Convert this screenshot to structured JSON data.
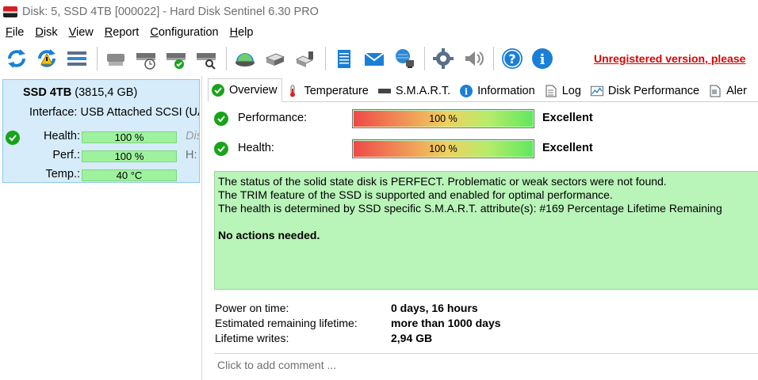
{
  "window": {
    "title": "Disk: 5, SSD 4TB [000022]  -  Hard Disk Sentinel 6.30 PRO"
  },
  "menu": [
    {
      "label": "File",
      "key": "F",
      "rest": "ile"
    },
    {
      "label": "Disk",
      "key": "D",
      "rest": "isk"
    },
    {
      "label": "View",
      "key": "V",
      "rest": "iew"
    },
    {
      "label": "Report",
      "key": "R",
      "rest": "eport"
    },
    {
      "label": "Configuration",
      "key": "C",
      "rest": "onfiguration"
    },
    {
      "label": "Help",
      "key": "H",
      "rest": "elp"
    }
  ],
  "toolbar": {
    "unregistered_text": "Unregistered version, please"
  },
  "disk_card": {
    "name": "SSD 4TB",
    "size": "(3815,4 GB)",
    "interface": "Interface: USB Attached SCSI (UA",
    "health_label": "Health:",
    "health_value": "100 %",
    "health_fraction": 1.0,
    "perf_label": "Perf.:",
    "perf_value": "100 %",
    "perf_fraction": 1.0,
    "temp_label": "Temp.:",
    "temp_value": "40 °C",
    "side_dis": "Dis",
    "side_h": "H:"
  },
  "tabs": [
    {
      "label": "Overview",
      "icon": "check-icon",
      "active": true
    },
    {
      "label": "Temperature",
      "icon": "thermometer-icon",
      "active": false
    },
    {
      "label": "S.M.A.R.T.",
      "icon": "drive-icon",
      "active": false
    },
    {
      "label": "Information",
      "icon": "info-icon",
      "active": false
    },
    {
      "label": "Log",
      "icon": "document-icon",
      "active": false
    },
    {
      "label": "Disk Performance",
      "icon": "performance-chart-icon",
      "active": false
    },
    {
      "label": "Aler",
      "icon": "alerts-icon",
      "active": false
    }
  ],
  "overview": {
    "performance_label": "Performance:",
    "performance_value": "100 %",
    "performance_fraction": 1.0,
    "performance_rating": "Excellent",
    "health_label": "Health:",
    "health_value": "100 %",
    "health_fraction": 1.0,
    "health_rating": "Excellent",
    "status_lines": [
      "The status of the solid state disk is PERFECT. Problematic or weak sectors were not found.",
      "The TRIM feature of the SSD is supported and enabled for optimal performance.",
      "The health is determined by SSD specific S.M.A.R.T. attribute(s):  #169 Percentage Lifetime Remaining"
    ],
    "action_text": "No actions needed.",
    "info": [
      {
        "label": "Power on time:",
        "value": "0 days, 16 hours"
      },
      {
        "label": "Estimated remaining lifetime:",
        "value": "more than 1000 days"
      },
      {
        "label": "Lifetime writes:",
        "value": "2,94 GB"
      }
    ],
    "comment_placeholder": "Click to add comment ..."
  },
  "colors": {
    "ok_green": "#19a319",
    "status_bg": "#b9f4b9",
    "card_bg": "#d6ecfb",
    "unregistered_red": "#e00000"
  }
}
